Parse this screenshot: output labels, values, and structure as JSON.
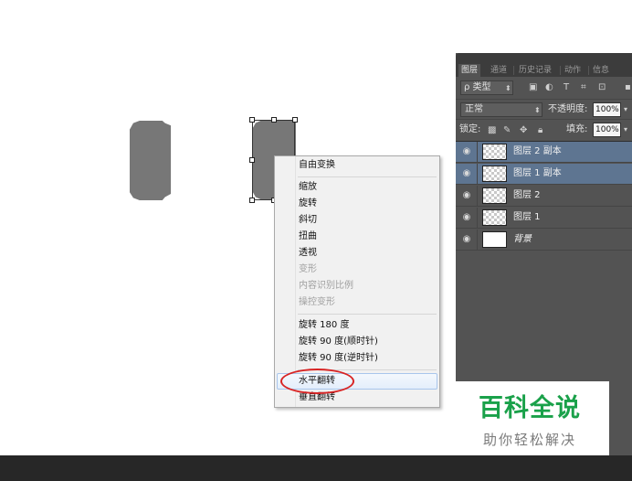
{
  "layers_panel": {
    "tabs": [
      "图层",
      "通道",
      "历史记录",
      "动作",
      "信息"
    ],
    "filter_label": "ρ 类型",
    "blend_mode": "正常",
    "opacity_label": "不透明度:",
    "opacity_value": "100%",
    "lock_label": "锁定:",
    "fill_label": "填充:",
    "fill_value": "100%",
    "layers": [
      {
        "name": "图层 2 副本",
        "selected": true
      },
      {
        "name": "图层 1 副本",
        "selected": true
      },
      {
        "name": "图层 2",
        "selected": false
      },
      {
        "name": "图层 1",
        "selected": false
      },
      {
        "name": "背景",
        "selected": false
      }
    ]
  },
  "context_menu": {
    "items": [
      {
        "label": "自由变换",
        "enabled": true
      },
      {
        "label": "缩放",
        "enabled": true
      },
      {
        "label": "旋转",
        "enabled": true
      },
      {
        "label": "斜切",
        "enabled": true
      },
      {
        "label": "扭曲",
        "enabled": true
      },
      {
        "label": "透视",
        "enabled": true
      },
      {
        "label": "变形",
        "enabled": false
      },
      {
        "label": "内容识别比例",
        "enabled": false
      },
      {
        "label": "操控变形",
        "enabled": false
      },
      {
        "label": "旋转 180 度",
        "enabled": true
      },
      {
        "label": "旋转 90 度(顺时针)",
        "enabled": true
      },
      {
        "label": "旋转 90 度(逆时针)",
        "enabled": true
      },
      {
        "label": "水平翻转",
        "enabled": true,
        "highlighted": true
      },
      {
        "label": "垂直翻转",
        "enabled": true
      }
    ]
  },
  "watermark": {
    "title": "百科全说",
    "subtitle": "助你轻松解决"
  },
  "colors": {
    "panel_bg": "#535353",
    "selected_layer": "#5e7591",
    "shape_fill": "#777777",
    "highlight_ellipse": "#d82424",
    "watermark_green": "#1aa14a"
  }
}
